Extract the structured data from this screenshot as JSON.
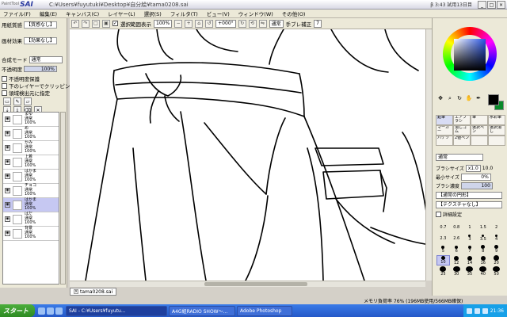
{
  "app": {
    "logo_small": "PaintTool",
    "logo_big": "SAI",
    "title": "C:¥Users¥fuyutuki¥Desktop¥自分絵¥tama0208.sai",
    "sys_info": "β 3:43 試用13日目",
    "window_buttons": [
      "_",
      "□",
      "×"
    ]
  },
  "menu": [
    "ファイル(F)",
    "編集(E)",
    "キャンバス(C)",
    "レイヤー(L)",
    "選択(S)",
    "フィルタ(T)",
    "ビュー(V)",
    "ウィンドウ(W)",
    "その他(O)"
  ],
  "toolbar": {
    "checkbox_label": "選択範囲表示",
    "zoom": "100%",
    "rotation": "+000°",
    "mode": "通常",
    "stabilizer_label": "手ブレ補正",
    "stabilizer_value": "7"
  },
  "left_panel": {
    "paper_label": "用紙質感",
    "paper_value": "【質感なし】",
    "effect_label": "画材効果",
    "effect_value": "【効果なし】",
    "blend_label": "合成モード",
    "blend_value": "通常",
    "opacity_label": "不透明度",
    "opacity_value": "100%",
    "checks": [
      "不透明度保護",
      "下のレイヤーでクリッピング",
      "領域検出元に指定"
    ],
    "layers": [
      {
        "name": "まゆ",
        "mode": "通常",
        "opacity": "100%",
        "selected": false
      },
      {
        "name": "め",
        "mode": "通常",
        "opacity": "100%",
        "selected": false
      },
      {
        "name": "かみ",
        "mode": "通常",
        "opacity": "100%",
        "selected": false
      },
      {
        "name": "上着",
        "mode": "通常",
        "opacity": "100%",
        "selected": false
      },
      {
        "name": "はかま",
        "mode": "通常",
        "opacity": "100%",
        "selected": false
      },
      {
        "name": "チョコ",
        "mode": "通常",
        "opacity": "100%",
        "selected": false
      },
      {
        "name": "はかま",
        "mode": "通常",
        "opacity": "100%",
        "selected": true
      },
      {
        "name": "はだ",
        "mode": "通常",
        "opacity": "100%",
        "selected": false
      },
      {
        "name": "背景",
        "mode": "通常",
        "opacity": "100%",
        "selected": false
      }
    ]
  },
  "document_tab": "tama0208.sai",
  "right_panel": {
    "tools_row1": [
      "鉛筆",
      "エアブラシ",
      "筆",
      "水彩筆"
    ],
    "tools_row2": [
      "マーカー",
      "消しゴム",
      "選択ペン",
      "選択消し"
    ],
    "tools_row3": [
      "バケツ",
      "2値ペン",
      "",
      ""
    ],
    "mode": "通常",
    "brush_size_label": "ブラシサイズ",
    "brush_size_mult": "x1.0",
    "brush_size_value": "10.0",
    "min_size_label": "最小サイズ",
    "min_size_value": "0%",
    "density_label": "ブラシ濃度",
    "density_value": "100",
    "shape_value": "【通常の円形】",
    "texture_value": "【テクスチャなし】",
    "detail_label": "詳細設定",
    "sizes": [
      "0.7",
      "0.8",
      "1",
      "1.5",
      "2",
      "2.3",
      "2.6",
      "3",
      "3.5",
      "4",
      "5",
      "6",
      "7",
      "8",
      "9",
      "10",
      "12",
      "14",
      "16",
      "20",
      "25",
      "30",
      "35",
      "40",
      "50"
    ],
    "selected_size": "10",
    "fg_color": "#000000",
    "bg_color": "#0a8a2a"
  },
  "status": "メモリ負荷率 76% (196MB使用/566MB確保)",
  "taskbar": {
    "start": "スタート",
    "tasks": [
      "SAI - C:¥Users¥fuyutu...",
      "A4G組RADIO SHOW～...",
      "Adobe Photoshop"
    ],
    "time": "21:36"
  }
}
